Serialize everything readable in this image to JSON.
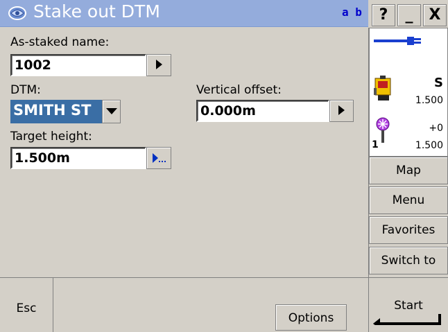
{
  "title": {
    "text": "Stake out DTM",
    "input_mode": "a b",
    "help": "?",
    "minimize": "_",
    "close": "X"
  },
  "form": {
    "as_staked_label": "As-staked name:",
    "as_staked_value": "1002",
    "dtm_label": "DTM:",
    "dtm_value": "SMITH ST",
    "vertical_offset_label": "Vertical offset:",
    "vertical_offset_value": "0.000m",
    "target_height_label": "Target height:",
    "target_height_value": "1.500m"
  },
  "status": {
    "instrument_face": "S",
    "instrument_height": "1.500",
    "target_offset": "+0",
    "target_id": "1",
    "target_height": "1.500"
  },
  "side_buttons": {
    "map": "Map",
    "menu": "Menu",
    "favorites": "Favorites",
    "switch_to": "Switch to"
  },
  "bottom": {
    "esc": "Esc",
    "options": "Options",
    "start": "Start"
  }
}
